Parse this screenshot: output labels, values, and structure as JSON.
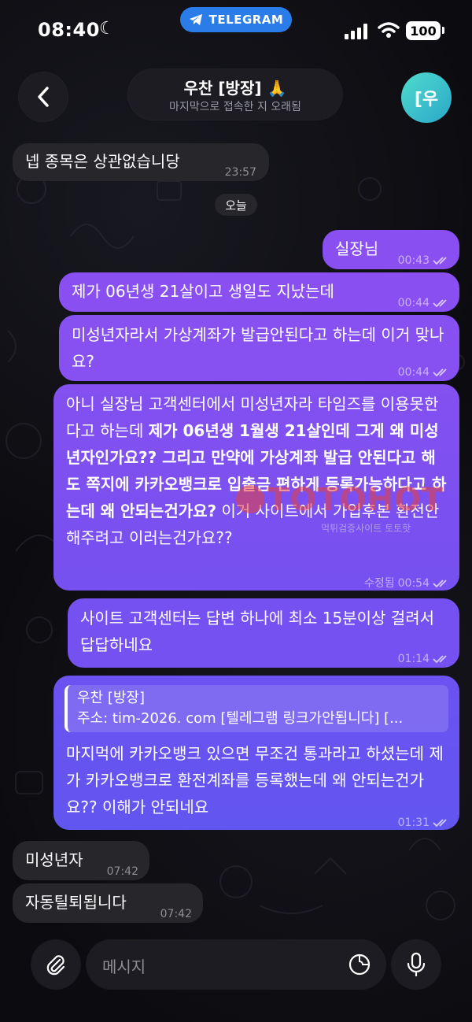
{
  "status_bar": {
    "time": "08:40",
    "app_pill": "TELEGRAM",
    "battery": "100"
  },
  "header": {
    "name": "우찬 [방장] 🙏",
    "subtitle": "마지막으로 접속한 지 오래됨",
    "avatar_text": "[우"
  },
  "date_divider": "오늘",
  "messages": [
    {
      "dir": "in",
      "text": "넵 종목은 상관없습니당",
      "time": "23:57"
    },
    {
      "dir": "out",
      "text": "실장님",
      "time": "00:43"
    },
    {
      "dir": "out",
      "text": "제가 06년생 21살이고 생일도 지났는데",
      "time": "00:44"
    },
    {
      "dir": "out",
      "text": "미성년자라서 가상계좌가 발급안된다고 하는데 이거 맞나요?",
      "time": "00:44"
    },
    {
      "dir": "out",
      "parts": [
        {
          "t": "아니 실장님 고객센터에서 미성년자라 타임즈를 이용못한다고 하는데 ",
          "b": false
        },
        {
          "t": "제가 06년생 1월생 21살인데 그게 왜 미성년자인가요?? 그리고 만약에 가상계좌 발급 안된다고 해도 쪽지에 카카오뱅크로 입출금 편하게 등록가능하다고 하는데 왜 안되는건가요?",
          "b": true
        },
        {
          "t": " 이거 사이트에서 가입후본 환전안해주려고 이러는건가요??",
          "b": false
        }
      ],
      "edited": "수정됨",
      "time": "00:54"
    },
    {
      "dir": "out",
      "text": "사이트 고객센터는 답변 하나에 최소 15분이상 걸려서 답답하네요",
      "time": "01:14"
    },
    {
      "dir": "out",
      "reply": {
        "name": "우찬 [방장]",
        "text": "주소: tim-2026. com [텔레그램 링크가안됩니다] [..."
      },
      "text": "마지먹에 카카오뱅크 있으면 무조건 통과라고 하셨는데 제가 카카오뱅크로 환전계좌를 등록했는데 왜 안되는건가요?? 이해가 안되네요",
      "time": "01:31"
    },
    {
      "dir": "in",
      "text": "미성년자",
      "time": "07:42"
    },
    {
      "dir": "in",
      "text": "자동틸퇴됩니다",
      "time": "07:42"
    }
  ],
  "watermark": {
    "main": "TOTOHOT",
    "sub": "먹튀검증사이트 토토핫"
  },
  "input": {
    "placeholder": "메시지"
  },
  "colors": {
    "out_top": "#8e4ff0",
    "out_bottom": "#6b4cf0",
    "in_bubble": "#26262b",
    "telegram_blue": "#2a7de8"
  }
}
